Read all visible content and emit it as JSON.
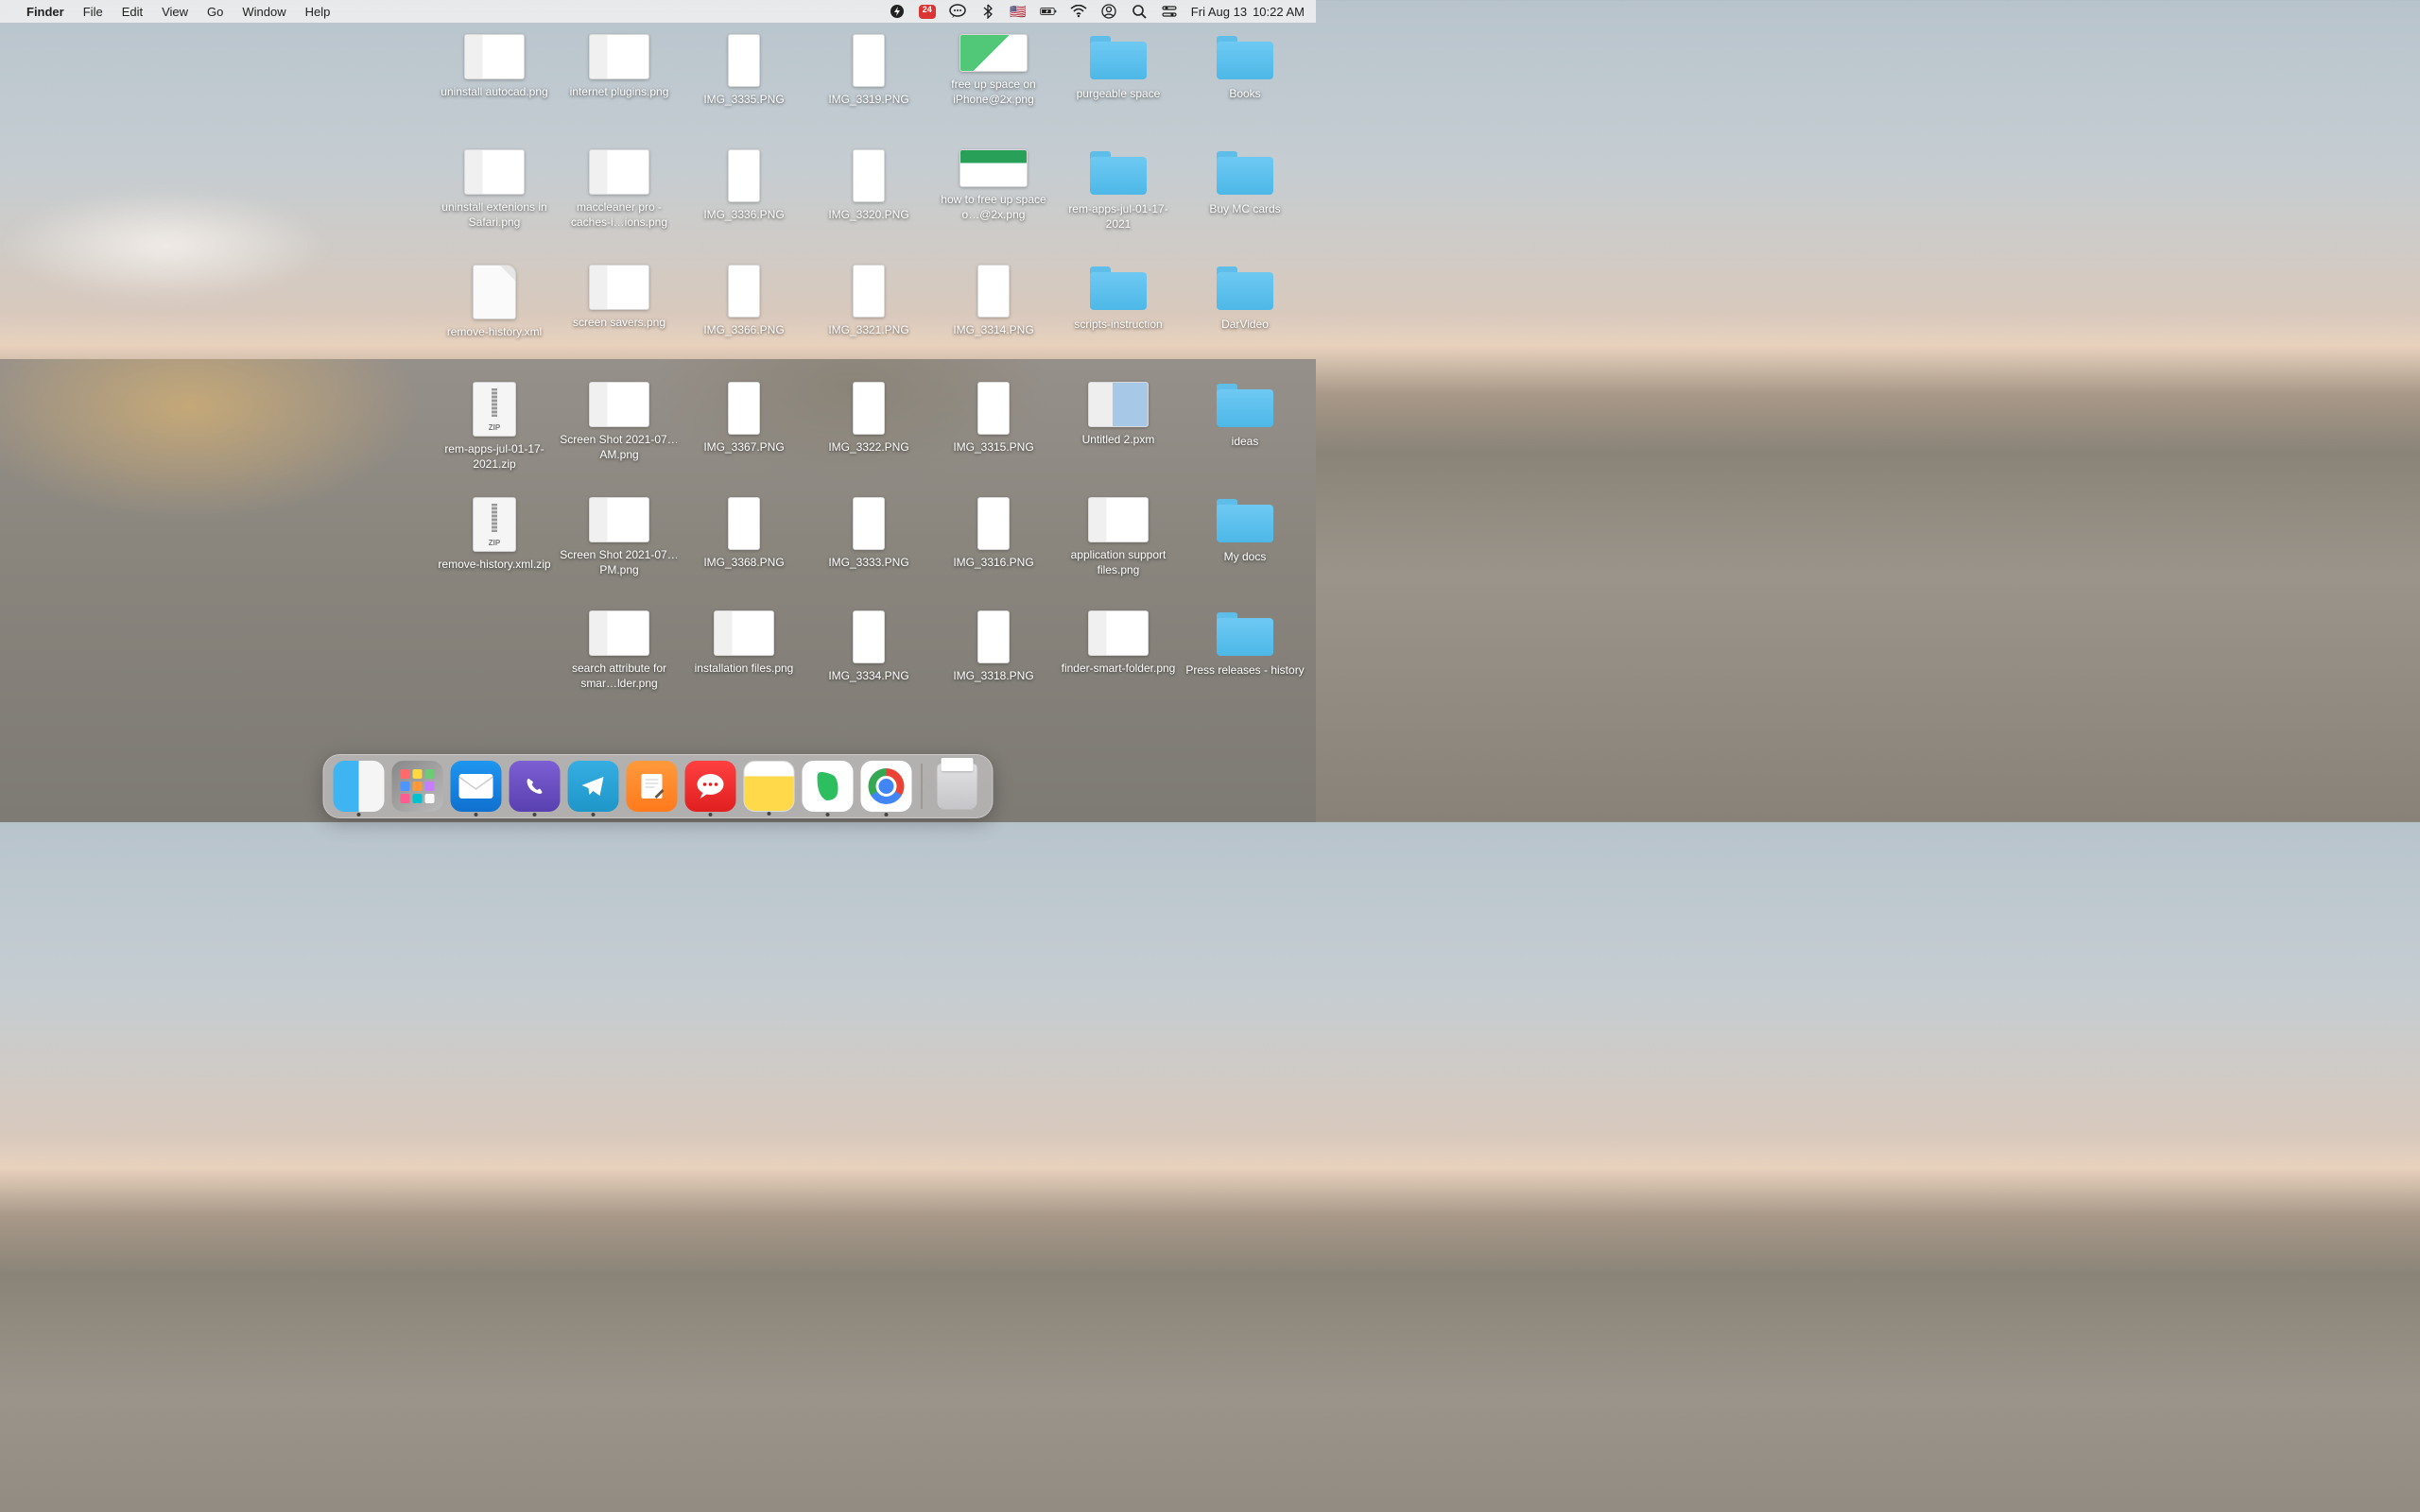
{
  "menubar": {
    "app": "Finder",
    "items": [
      "File",
      "Edit",
      "View",
      "Go",
      "Window",
      "Help"
    ],
    "notif_count": "24",
    "date": "Fri Aug 13",
    "time": "10:22 AM"
  },
  "desktop": {
    "columns": [
      [
        {
          "label": "uninstall autocad.png",
          "type": "img",
          "name": "file-uninstall-autocad"
        },
        {
          "label": "uninstall extenions in Safari.png",
          "type": "img",
          "name": "file-uninstall-extensions-safari"
        },
        {
          "label": "remove-history.xml",
          "type": "doc",
          "name": "file-remove-history-xml"
        },
        {
          "label": "rem-apps-jul-01-17-2021.zip",
          "type": "zip",
          "name": "file-rem-apps-zip"
        },
        {
          "label": "remove-history.xml.zip",
          "type": "zip",
          "name": "file-remove-history-zip"
        }
      ],
      [
        {
          "label": "internet plugins.png",
          "type": "img",
          "name": "file-internet-plugins"
        },
        {
          "label": "maccleaner pro - caches-i…ions.png",
          "type": "img",
          "name": "file-maccleaner-caches"
        },
        {
          "label": "screen savers.png",
          "type": "img",
          "name": "file-screen-savers"
        },
        {
          "label": "Screen Shot 2021-07…AM.png",
          "type": "img",
          "name": "file-screenshot-am"
        },
        {
          "label": "Screen Shot 2021-07…PM.png",
          "type": "img",
          "name": "file-screenshot-pm"
        },
        {
          "label": "search attribute for smar…lder.png",
          "type": "img",
          "name": "file-search-attribute"
        }
      ],
      [
        {
          "label": "IMG_3335.PNG",
          "type": "tall",
          "name": "file-img-3335"
        },
        {
          "label": "IMG_3336.PNG",
          "type": "tall",
          "name": "file-img-3336"
        },
        {
          "label": "IMG_3366.PNG",
          "type": "tall",
          "name": "file-img-3366"
        },
        {
          "label": "IMG_3367.PNG",
          "type": "tall",
          "name": "file-img-3367"
        },
        {
          "label": "IMG_3368.PNG",
          "type": "tall",
          "name": "file-img-3368"
        },
        {
          "label": "installation files.png",
          "type": "img",
          "name": "file-installation-files"
        }
      ],
      [
        {
          "label": "IMG_3319.PNG",
          "type": "tall",
          "name": "file-img-3319"
        },
        {
          "label": "IMG_3320.PNG",
          "type": "tall",
          "name": "file-img-3320"
        },
        {
          "label": "IMG_3321.PNG",
          "type": "tall",
          "name": "file-img-3321"
        },
        {
          "label": "IMG_3322.PNG",
          "type": "tall",
          "name": "file-img-3322"
        },
        {
          "label": "IMG_3333.PNG",
          "type": "tall",
          "name": "file-img-3333"
        },
        {
          "label": "IMG_3334.PNG",
          "type": "tall",
          "name": "file-img-3334"
        }
      ],
      [
        {
          "label": "free up space on iPhone@2x.png",
          "type": "wide-c",
          "name": "file-free-up-space"
        },
        {
          "label": "how to free up space o…@2x.png",
          "type": "wide-d",
          "name": "file-how-to-free-up"
        },
        {
          "label": "IMG_3314.PNG",
          "type": "tall",
          "name": "file-img-3314"
        },
        {
          "label": "IMG_3315.PNG",
          "type": "tall",
          "name": "file-img-3315"
        },
        {
          "label": "IMG_3316.PNG",
          "type": "tall",
          "name": "file-img-3316"
        },
        {
          "label": "IMG_3318.PNG",
          "type": "tall",
          "name": "file-img-3318"
        }
      ],
      [
        {
          "label": "purgeable space",
          "type": "folder",
          "name": "folder-purgeable-space"
        },
        {
          "label": "rem-apps-jul-01-17-2021",
          "type": "folder",
          "name": "folder-rem-apps"
        },
        {
          "label": "scripts-instruction",
          "type": "folder",
          "name": "folder-scripts-instruction"
        },
        {
          "label": "Untitled 2.pxm",
          "type": "img-e",
          "name": "file-untitled-pxm"
        },
        {
          "label": "application support files.png",
          "type": "img",
          "name": "file-app-support"
        },
        {
          "label": "finder-smart-folder.png",
          "type": "img",
          "name": "file-finder-smart-folder"
        }
      ],
      [
        {
          "label": "Books",
          "type": "folder",
          "name": "folder-books"
        },
        {
          "label": "Buy MC cards",
          "type": "folder",
          "name": "folder-buy-mc-cards"
        },
        {
          "label": "DarVideo",
          "type": "folder",
          "name": "folder-darvideo"
        },
        {
          "label": "ideas",
          "type": "folder",
          "name": "folder-ideas"
        },
        {
          "label": "My docs",
          "type": "folder",
          "name": "folder-my-docs"
        },
        {
          "label": "Press releases - history",
          "type": "folder",
          "name": "folder-press-releases"
        }
      ]
    ],
    "col_x": [
      458,
      590,
      722,
      854,
      986,
      1118,
      1252
    ],
    "row_y": [
      12,
      134,
      256,
      380,
      502,
      622
    ]
  },
  "dock": {
    "apps": [
      {
        "name": "finder",
        "label": "Finder",
        "running": true
      },
      {
        "name": "launchpad",
        "label": "Launchpad",
        "running": false
      },
      {
        "name": "mail",
        "label": "Mail",
        "running": true
      },
      {
        "name": "viber",
        "label": "Viber",
        "running": true
      },
      {
        "name": "telegram",
        "label": "Telegram",
        "running": true
      },
      {
        "name": "pages",
        "label": "Pages",
        "running": false
      },
      {
        "name": "imessage",
        "label": "iMessage",
        "running": true
      },
      {
        "name": "notes",
        "label": "Notes",
        "running": true
      },
      {
        "name": "evernote",
        "label": "Evernote",
        "running": true
      },
      {
        "name": "chrome",
        "label": "Chrome",
        "running": true
      }
    ],
    "trash": "Trash"
  }
}
